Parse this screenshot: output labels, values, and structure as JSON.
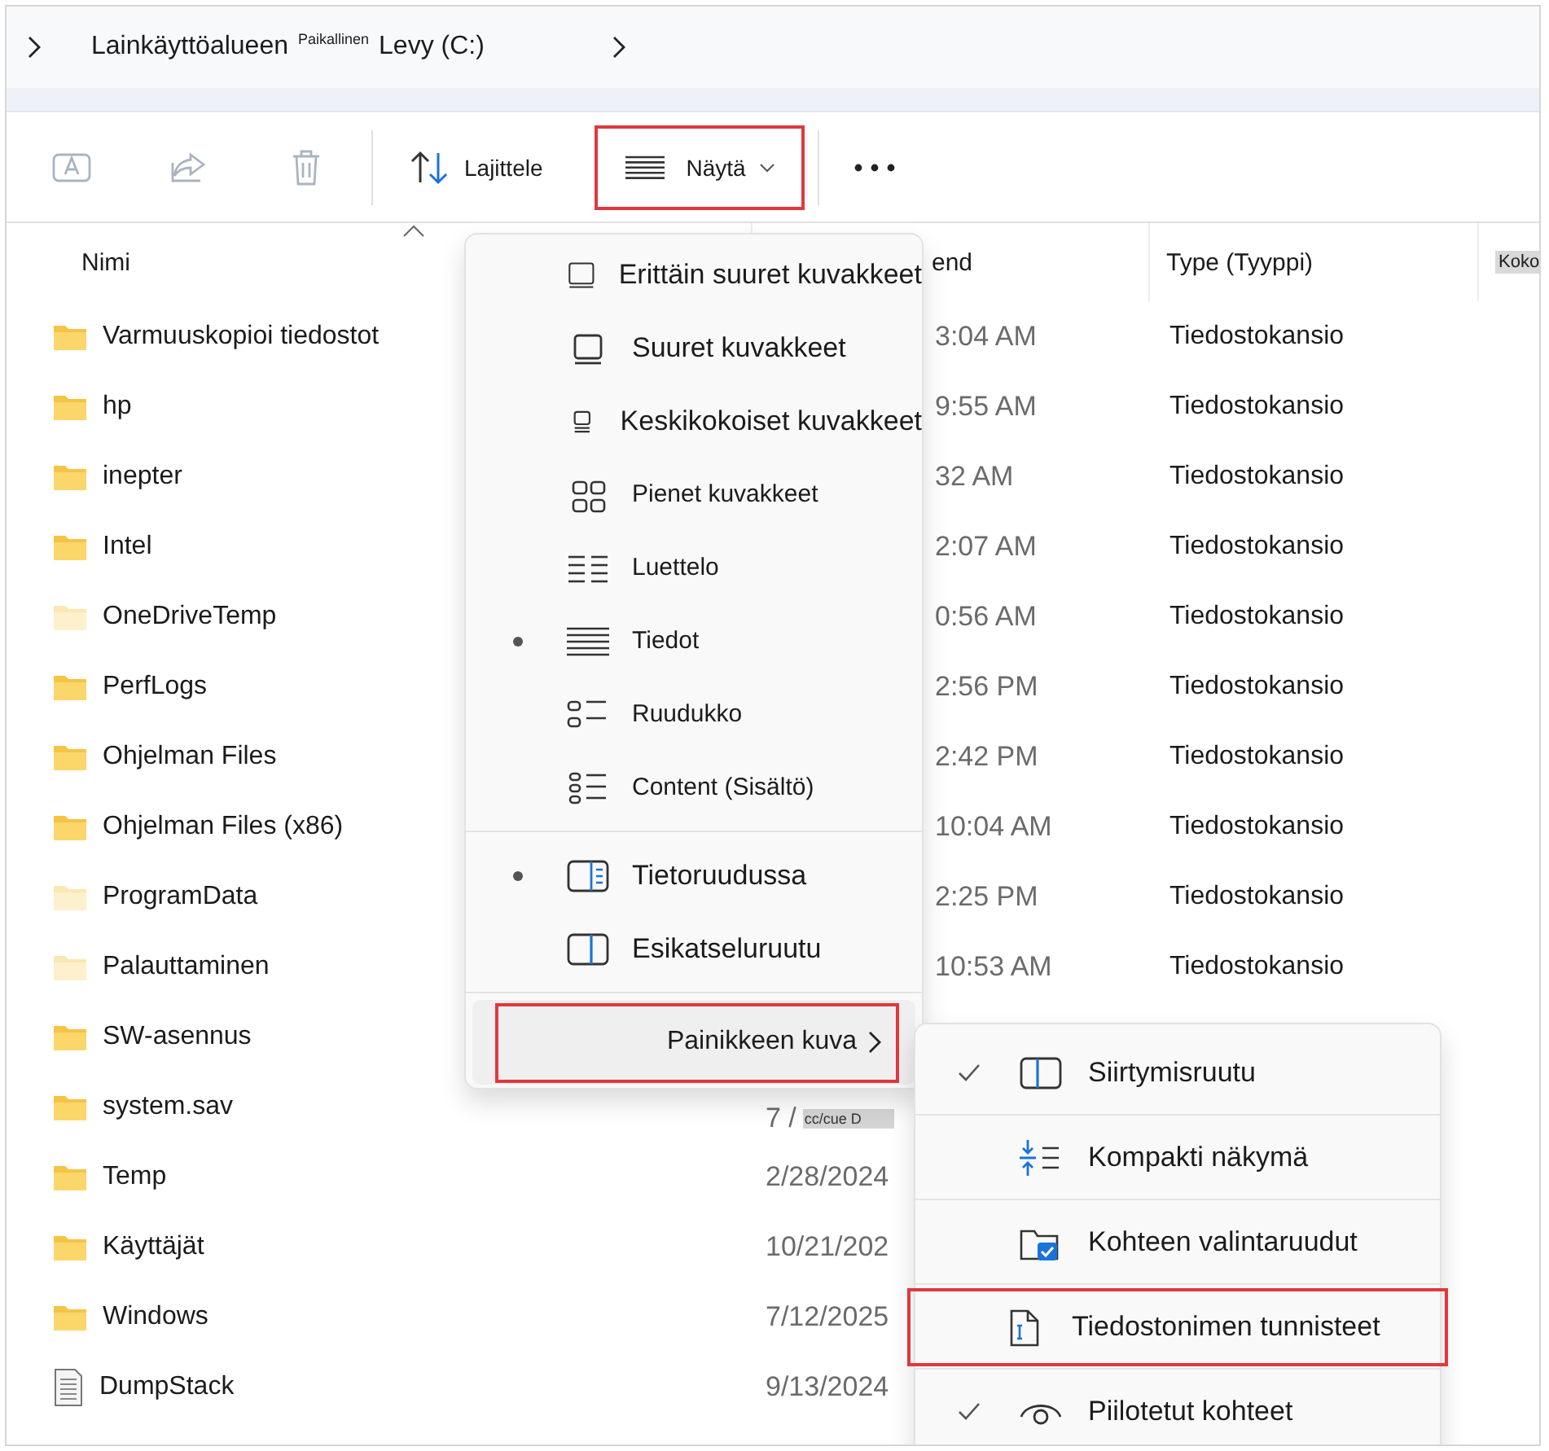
{
  "breadcrumb": {
    "items": [
      "Lainkäyttöalueen",
      "Paikallinen",
      "Levy (C:)"
    ]
  },
  "toolbar": {
    "buttons": [
      {
        "kind": "rename",
        "disabled": true
      },
      {
        "kind": "share",
        "disabled": true
      },
      {
        "kind": "delete",
        "disabled": true
      }
    ],
    "sort": {
      "label": "Lajittele"
    },
    "view": {
      "label": "Näytä",
      "callout": true
    }
  },
  "columns": [
    {
      "label": "Nimi"
    },
    {
      "label": "end"
    },
    {
      "label": "Type (Tyyppi)"
    },
    {
      "label": "Koko",
      "highlighted": true
    }
  ],
  "rows": [
    {
      "kind": "folder",
      "hidden": false,
      "name": "Varmuuskopioi tiedostot",
      "date": "3:04 AM",
      "cut": true,
      "type": "Tiedostokansio"
    },
    {
      "kind": "folder",
      "hidden": false,
      "name": "hp",
      "date": "9:55 AM",
      "cut": true,
      "type": "Tiedostokansio"
    },
    {
      "kind": "folder",
      "hidden": false,
      "name": "inepter",
      "date": "32 AM",
      "cut": true,
      "type": "Tiedostokansio"
    },
    {
      "kind": "folder",
      "hidden": false,
      "name": "Intel",
      "date": "2:07 AM",
      "cut": true,
      "type": "Tiedostokansio"
    },
    {
      "kind": "folder",
      "hidden": true,
      "name": "OneDriveTemp",
      "date": "0:56 AM",
      "cut": true,
      "type": "Tiedostokansio"
    },
    {
      "kind": "folder",
      "hidden": false,
      "name": "PerfLogs",
      "date": "2:56 PM",
      "cut": true,
      "type": "Tiedostokansio"
    },
    {
      "kind": "folder",
      "hidden": false,
      "name": "Ohjelman Files",
      "date": "2:42 PM",
      "cut": true,
      "type": "Tiedostokansio"
    },
    {
      "kind": "folder",
      "hidden": false,
      "name": "Ohjelman Files (x86)",
      "date": "10:04 AM",
      "cut": true,
      "type": "Tiedostokansio"
    },
    {
      "kind": "folder",
      "hidden": true,
      "name": "ProgramData",
      "date": "2:25 PM",
      "cut": true,
      "type": "Tiedostokansio"
    },
    {
      "kind": "folder",
      "hidden": true,
      "name": "Palauttaminen",
      "date": "10:53 AM",
      "cut": true,
      "type": "Tiedostokansio"
    },
    {
      "kind": "folder",
      "hidden": false,
      "name": "SW-asennus"
    },
    {
      "kind": "folder",
      "hidden": false,
      "name": "system.sav",
      "date": "7 /",
      "note": "cc/cue D"
    },
    {
      "kind": "folder",
      "hidden": false,
      "name": "Temp",
      "date": "2/28/2024"
    },
    {
      "kind": "folder",
      "hidden": false,
      "name": "Käyttäjät",
      "date": "10/21/202"
    },
    {
      "kind": "folder",
      "hidden": false,
      "name": "Windows",
      "date": "7/12/2025"
    },
    {
      "kind": "file",
      "hidden": false,
      "name": "DumpStack",
      "date": "9/13/2024"
    }
  ],
  "view_menu": {
    "groups": [
      [
        {
          "kind": "option",
          "label": "Erittäin suuret kuvakkeet",
          "selected": false
        },
        {
          "kind": "option",
          "label": "Suuret kuvakkeet",
          "selected": false
        },
        {
          "kind": "option",
          "label": "Keskikokoiset kuvakkeet",
          "selected": false
        },
        {
          "kind": "option",
          "label": "Pienet kuvakkeet",
          "selected": false
        },
        {
          "kind": "option",
          "label": "Luettelo",
          "selected": false
        },
        {
          "kind": "option",
          "label": "Tiedot",
          "selected": true
        },
        {
          "kind": "option",
          "label": "Ruudukko",
          "selected": false
        },
        {
          "kind": "option",
          "label": "Content (Sisältö)",
          "selected": false
        }
      ],
      [
        {
          "kind": "option",
          "label": "Tietoruudussa",
          "selected": true
        },
        {
          "kind": "option",
          "label": "Esikatseluruutu",
          "selected": false
        }
      ],
      [
        {
          "kind": "submenu",
          "label": "Painikkeen kuva",
          "hovered": true,
          "callout": true
        }
      ]
    ]
  },
  "show_menu": {
    "items": [
      {
        "label": "Siirtymisruutu",
        "checked": true,
        "callout": false
      },
      {
        "label": "Kompakti näkymä",
        "checked": false,
        "callout": false
      },
      {
        "label": "Kohteen valintaruudut",
        "checked": false,
        "callout": false
      },
      {
        "label": "Tiedostonimen tunnisteet",
        "checked": false,
        "callout": true
      },
      {
        "label": "Piilotetut kohteet",
        "checked": true,
        "callout": false
      }
    ]
  }
}
